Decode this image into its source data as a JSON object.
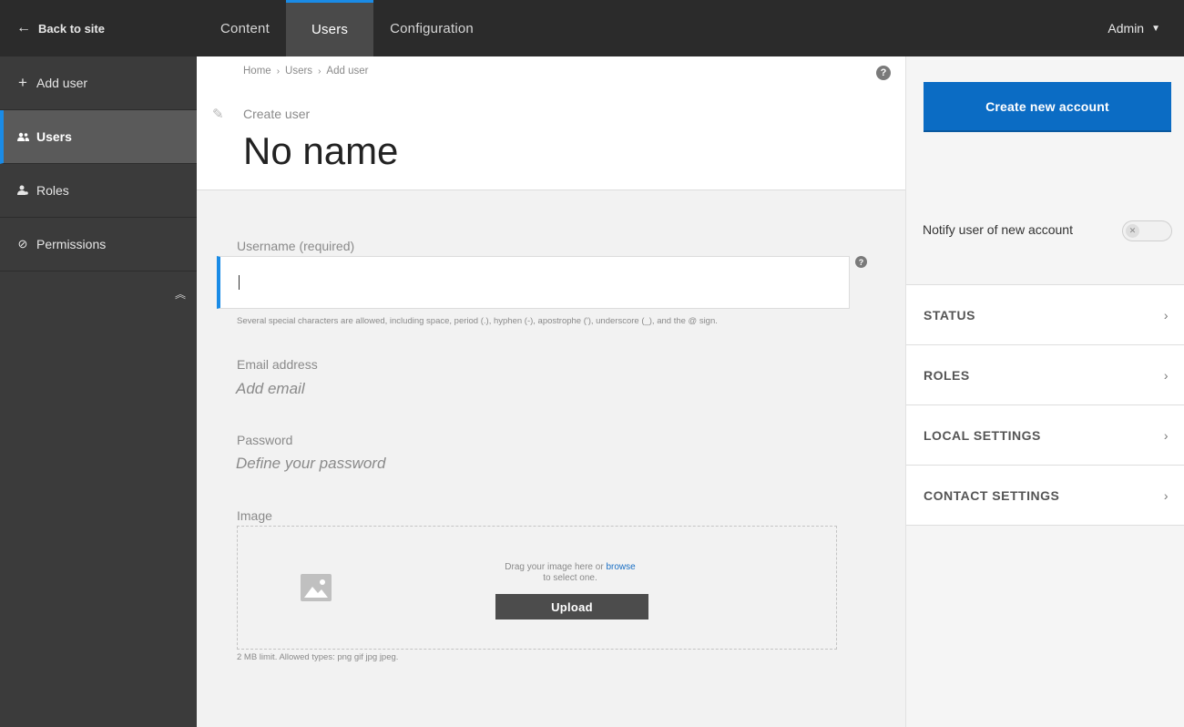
{
  "topbar": {
    "back_label": "Back to site",
    "tabs": [
      {
        "label": "Content"
      },
      {
        "label": "Users"
      },
      {
        "label": "Configuration"
      }
    ],
    "user_menu": "Admin"
  },
  "sidebar": {
    "items": [
      {
        "label": "Add user",
        "icon": "plus-icon"
      },
      {
        "label": "Users",
        "icon": "users-icon"
      },
      {
        "label": "Roles",
        "icon": "roles-icon"
      },
      {
        "label": "Permissions",
        "icon": "permissions-icon"
      }
    ],
    "active_item": "Users"
  },
  "header": {
    "breadcrumb": [
      "Home",
      "Users",
      "Add user"
    ],
    "subtitle": "Create user",
    "title": "No name"
  },
  "form": {
    "username": {
      "label": "Username (required)",
      "value": "",
      "hint": "Several special characters are allowed, including space, period (.), hyphen (-), apostrophe ('), underscore (_), and the @ sign."
    },
    "email": {
      "label": "Email address",
      "placeholder": "Add email"
    },
    "password": {
      "label": "Password",
      "placeholder": "Define your password"
    },
    "image": {
      "label": "Image",
      "drop_text": "Drag your image here or",
      "browse_link": "browse",
      "drop_text_2": "to select one.",
      "upload_label": "Upload",
      "limits": "2 MB limit. Allowed types: png gif jpg jpeg."
    }
  },
  "panel": {
    "create_button": "Create new account",
    "notify_label": "Notify user of new account",
    "notify_enabled": false,
    "sections": [
      "STATUS",
      "ROLES",
      "LOCAL SETTINGS",
      "CONTACT SETTINGS"
    ]
  },
  "colors": {
    "accent": "#1a8be6",
    "primary_button": "#0b6cc4",
    "topbar": "#2b2b2b",
    "sidebar": "#3b3b3b"
  }
}
